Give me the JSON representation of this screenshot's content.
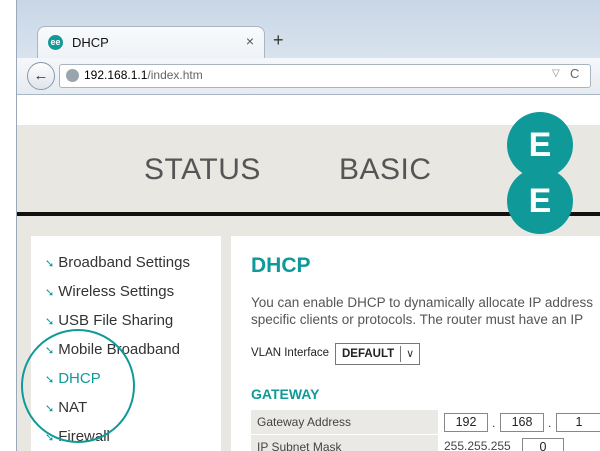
{
  "browser": {
    "tab_title": "DHCP",
    "tab_close": "×",
    "new_tab": "+",
    "favicon_letters": "ee",
    "url_host": "192.168.1.1",
    "url_path": "/index.htm",
    "back_glyph": "←",
    "dropdown_glyph": "▽",
    "reload_glyph": "C"
  },
  "header": {
    "nav": [
      "STATUS",
      "BASIC"
    ],
    "logo_letters": [
      "E",
      "E"
    ],
    "accent_color": "#0f9a99"
  },
  "sidebar": {
    "items": [
      {
        "label": "Broadband Settings",
        "active": false
      },
      {
        "label": "Wireless Settings",
        "active": false
      },
      {
        "label": "USB File Sharing",
        "active": false
      },
      {
        "label": "Mobile Broadband",
        "active": false
      },
      {
        "label": "DHCP",
        "active": true
      },
      {
        "label": "NAT",
        "active": false
      },
      {
        "label": "Firewall",
        "active": false
      }
    ]
  },
  "main": {
    "title": "DHCP",
    "description_line1": "You can enable DHCP to dynamically allocate IP address",
    "description_line2": "specific clients or protocols. The router must have an IP",
    "vlan_label": "VLAN Interface",
    "vlan_value": "DEFAULT",
    "section_title": "GATEWAY",
    "rows": [
      {
        "label": "Gateway Address",
        "octets": [
          "192",
          "168",
          "1"
        ]
      },
      {
        "label": "IP Subnet Mask",
        "octets": [
          "255.255.255",
          "0"
        ]
      }
    ]
  }
}
